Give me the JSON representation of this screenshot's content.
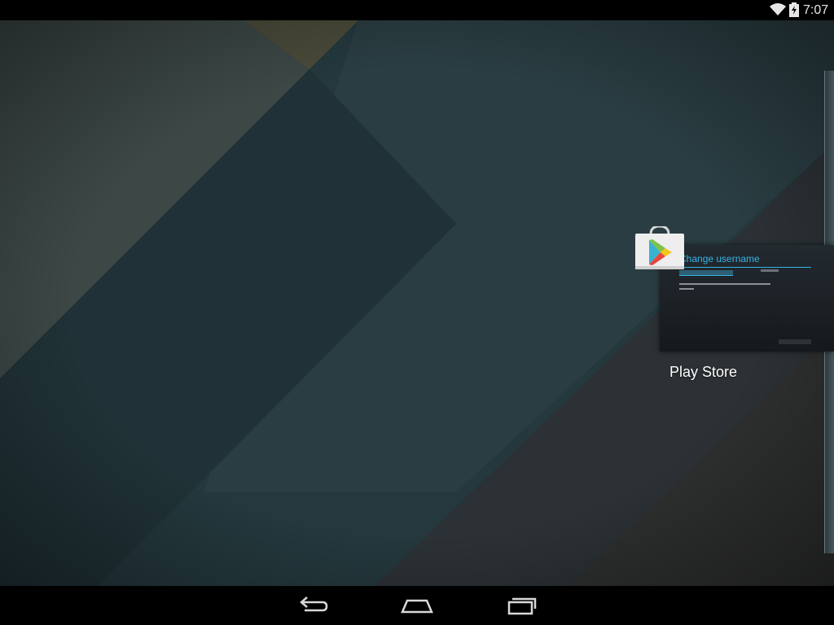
{
  "status_bar": {
    "time": "7:07",
    "icons": [
      "wifi-icon",
      "battery-charging-icon"
    ]
  },
  "recents": {
    "cards": [
      {
        "app_label": "Play Store",
        "icon": "play-store-icon",
        "thumbnail_title": "Change username"
      }
    ]
  },
  "nav_bar": {
    "buttons": [
      "back-icon",
      "home-icon",
      "recents-icon"
    ]
  },
  "colors": {
    "accent": "#33b5e5",
    "wallpaper": "#22353a",
    "bar": "#000000"
  }
}
